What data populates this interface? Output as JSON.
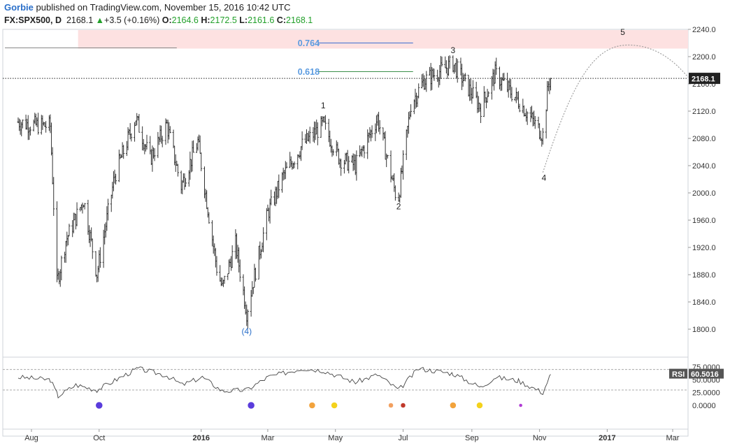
{
  "header": {
    "author": "Gorbie",
    "published_text": "published on TradingView.com, November 15, 2016 10:42 UTC",
    "symbol": "FX:SPX500, D",
    "last": "2168.1",
    "change": "+3.5 (+0.16%)",
    "open_label": "O:",
    "open": "2164.6",
    "high_label": "H:",
    "high": "2172.5",
    "low_label": "L:",
    "low": "2161.6",
    "close_label": "C:",
    "close": "2168.1",
    "up_arrow": "▲"
  },
  "colors": {
    "bars": "#333333",
    "fib_line": "#3b6fd0",
    "fib_line2": "#3a8f4a",
    "fib_label": "#5b9be0",
    "red_zone": "#fde1e1",
    "wave4_label": "#2a6fc9",
    "rsi_line": "#444444"
  },
  "chart_data": {
    "type": "ohlc",
    "title": "FX:SPX500, D",
    "ylim": [
      1760,
      2240
    ],
    "y_ticks": [
      "2240.0",
      "2200.0",
      "2160.0",
      "2120.0",
      "2080.0",
      "2040.0",
      "2000.0",
      "1960.0",
      "1920.0",
      "1880.0",
      "1840.0",
      "1800.0"
    ],
    "x_ticks": [
      "Aug",
      "Oct",
      "2016",
      "Mar",
      "May",
      "Jul",
      "Sep",
      "Nov",
      "2017",
      "Mar"
    ],
    "x_tick_values": [
      "2015-08-01",
      "2015-10-01",
      "2016-01-01",
      "2016-03-01",
      "2016-05-01",
      "2016-07-01",
      "2016-09-01",
      "2016-11-01",
      "2017-01-01",
      "2017-03-01"
    ],
    "price_label": "2168.1",
    "series": [
      {
        "date": "2015-07-20",
        "close": 2104
      },
      {
        "date": "2015-08-01",
        "close": 2100
      },
      {
        "date": "2015-08-18",
        "close": 2098
      },
      {
        "date": "2015-08-24",
        "close": 1867
      },
      {
        "date": "2015-09-01",
        "close": 1930
      },
      {
        "date": "2015-09-17",
        "close": 1990
      },
      {
        "date": "2015-09-29",
        "close": 1881
      },
      {
        "date": "2015-10-15",
        "close": 2025
      },
      {
        "date": "2015-11-03",
        "close": 2110
      },
      {
        "date": "2015-11-16",
        "close": 2050
      },
      {
        "date": "2015-12-01",
        "close": 2100
      },
      {
        "date": "2015-12-14",
        "close": 2010
      },
      {
        "date": "2015-12-29",
        "close": 2075
      },
      {
        "date": "2016-01-15",
        "close": 1890
      },
      {
        "date": "2016-01-20",
        "close": 1860
      },
      {
        "date": "2016-02-01",
        "close": 1925
      },
      {
        "date": "2016-02-11",
        "close": 1825
      },
      {
        "date": "2016-03-01",
        "close": 1970
      },
      {
        "date": "2016-03-15",
        "close": 2025
      },
      {
        "date": "2016-04-01",
        "close": 2070
      },
      {
        "date": "2016-04-20",
        "close": 2100
      },
      {
        "date": "2016-05-05",
        "close": 2050
      },
      {
        "date": "2016-05-19",
        "close": 2040
      },
      {
        "date": "2016-06-08",
        "close": 2110
      },
      {
        "date": "2016-06-24",
        "close": 2000
      },
      {
        "date": "2016-06-27",
        "close": 1995
      },
      {
        "date": "2016-07-08",
        "close": 2130
      },
      {
        "date": "2016-07-20",
        "close": 2165
      },
      {
        "date": "2016-08-15",
        "close": 2190
      },
      {
        "date": "2016-09-09",
        "close": 2125
      },
      {
        "date": "2016-09-22",
        "close": 2175
      },
      {
        "date": "2016-10-13",
        "close": 2135
      },
      {
        "date": "2016-11-04",
        "close": 2085
      },
      {
        "date": "2016-11-09",
        "close": 2160
      },
      {
        "date": "2016-11-11",
        "close": 2168.1
      }
    ],
    "wave_labels": [
      {
        "text": "(4)",
        "date": "2016-02-11",
        "y": 1793,
        "color": "#2a6fc9"
      },
      {
        "text": "1",
        "date": "2016-04-20",
        "y": 2124
      },
      {
        "text": "2",
        "date": "2016-06-27",
        "y": 1976
      },
      {
        "text": "3",
        "date": "2016-08-15",
        "y": 2205
      },
      {
        "text": "4",
        "date": "2016-11-05",
        "y": 2018
      },
      {
        "text": "5",
        "date": "2017-01-15",
        "y": 2232
      }
    ],
    "fib_levels": [
      {
        "label": "0.764",
        "value": 2220
      },
      {
        "label": "0.618",
        "value": 2178
      }
    ],
    "projection": [
      {
        "date": "2016-11-04",
        "value": 2030
      },
      {
        "date": "2016-12-01",
        "value": 2165
      },
      {
        "date": "2017-01-20",
        "value": 2217
      },
      {
        "date": "2017-03-10",
        "value": 2178
      }
    ],
    "rsi": {
      "label": "RSI",
      "value": "60.5016",
      "ticks": [
        "75.0000",
        "50.0000",
        "25.0000",
        "0.0000"
      ],
      "bands": [
        70,
        30
      ],
      "series": [
        {
          "date": "2015-07-20",
          "value": 55
        },
        {
          "date": "2015-08-18",
          "value": 50
        },
        {
          "date": "2015-08-25",
          "value": 18
        },
        {
          "date": "2015-09-10",
          "value": 40
        },
        {
          "date": "2015-09-29",
          "value": 30
        },
        {
          "date": "2015-10-25",
          "value": 60
        },
        {
          "date": "2015-11-05",
          "value": 72
        },
        {
          "date": "2015-12-01",
          "value": 58
        },
        {
          "date": "2015-12-15",
          "value": 40
        },
        {
          "date": "2016-01-02",
          "value": 55
        },
        {
          "date": "2016-01-20",
          "value": 28
        },
        {
          "date": "2016-02-11",
          "value": 30
        },
        {
          "date": "2016-03-01",
          "value": 55
        },
        {
          "date": "2016-04-01",
          "value": 72
        },
        {
          "date": "2016-04-20",
          "value": 68
        },
        {
          "date": "2016-05-19",
          "value": 45
        },
        {
          "date": "2016-06-08",
          "value": 60
        },
        {
          "date": "2016-06-27",
          "value": 30
        },
        {
          "date": "2016-07-15",
          "value": 72
        },
        {
          "date": "2016-08-15",
          "value": 62
        },
        {
          "date": "2016-09-09",
          "value": 35
        },
        {
          "date": "2016-09-22",
          "value": 55
        },
        {
          "date": "2016-10-13",
          "value": 48
        },
        {
          "date": "2016-11-04",
          "value": 25
        },
        {
          "date": "2016-11-11",
          "value": 60.5
        }
      ]
    },
    "events": [
      {
        "date": "2015-10-01",
        "color": "#5a3cdc",
        "size": 5
      },
      {
        "date": "2016-02-15",
        "color": "#5a3cdc",
        "size": 5
      },
      {
        "date": "2016-04-10",
        "color": "#f2a33c",
        "size": 4.5
      },
      {
        "date": "2016-04-30",
        "color": "#f4d21c",
        "size": 4.5
      },
      {
        "date": "2016-06-20",
        "color": "#f2a060",
        "size": 3.5
      },
      {
        "date": "2016-07-01",
        "color": "#c0392b",
        "size": 3.5
      },
      {
        "date": "2016-08-15",
        "color": "#f2a33c",
        "size": 4.5
      },
      {
        "date": "2016-09-08",
        "color": "#f4d21c",
        "size": 4.5
      },
      {
        "date": "2016-10-15",
        "color": "#b03ad4",
        "size": 2.5
      }
    ]
  }
}
